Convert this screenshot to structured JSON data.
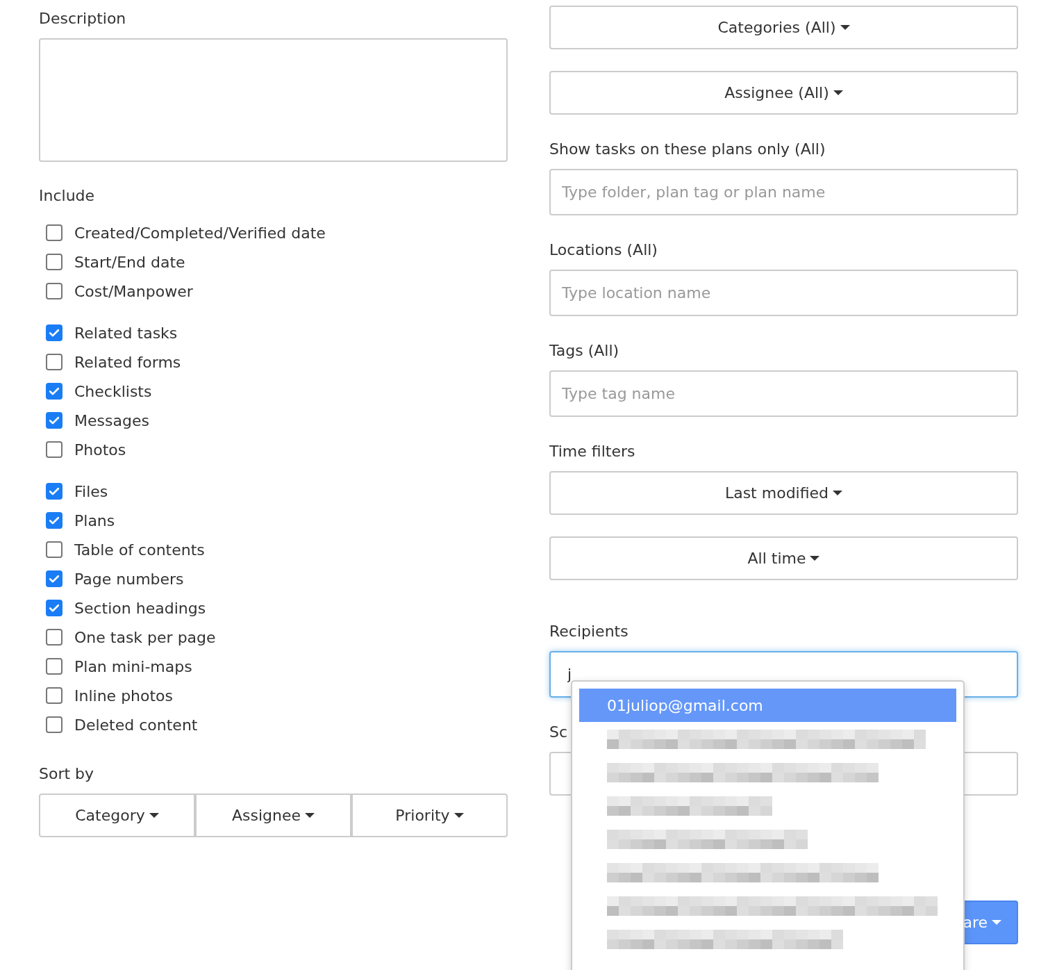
{
  "left": {
    "description": {
      "label": "Description"
    },
    "include": {
      "label": "Include",
      "groups": [
        [
          {
            "label": "Created/Completed/Verified date",
            "checked": false
          },
          {
            "label": "Start/End date",
            "checked": false
          },
          {
            "label": "Cost/Manpower",
            "checked": false
          }
        ],
        [
          {
            "label": "Related tasks",
            "checked": true
          },
          {
            "label": "Related forms",
            "checked": false
          },
          {
            "label": "Checklists",
            "checked": true
          },
          {
            "label": "Messages",
            "checked": true
          },
          {
            "label": "Photos",
            "checked": false
          }
        ],
        [
          {
            "label": "Files",
            "checked": true
          },
          {
            "label": "Plans",
            "checked": true
          },
          {
            "label": "Table of contents",
            "checked": false
          },
          {
            "label": "Page numbers",
            "checked": true
          },
          {
            "label": "Section headings",
            "checked": true
          },
          {
            "label": "One task per page",
            "checked": false
          },
          {
            "label": "Plan mini-maps",
            "checked": false
          },
          {
            "label": "Inline photos",
            "checked": false
          },
          {
            "label": "Deleted content",
            "checked": false
          }
        ]
      ]
    },
    "sort": {
      "label": "Sort by",
      "buttons": [
        "Category",
        "Assignee",
        "Priority"
      ]
    }
  },
  "right": {
    "filter_buttons": [
      "Categories (All)",
      "Assignee (All)"
    ],
    "fields": [
      {
        "label": "Show tasks on these plans only (All)",
        "placeholder": "Type folder, plan tag or plan name"
      },
      {
        "label": "Locations (All)",
        "placeholder": "Type location name"
      },
      {
        "label": "Tags (All)",
        "placeholder": "Type tag name"
      }
    ],
    "time_filters": {
      "label": "Time filters",
      "buttons": [
        "Last modified",
        "All time"
      ]
    },
    "recipients": {
      "label": "Recipients",
      "value": "j"
    },
    "schedule_label": "Sc",
    "share_button": "are",
    "suggestions": [
      {
        "kind": "email",
        "text": "01juliop@gmail.com",
        "selected": true
      },
      {
        "kind": "redacted",
        "selected": false
      },
      {
        "kind": "redacted",
        "selected": false
      },
      {
        "kind": "redacted",
        "selected": false
      },
      {
        "kind": "redacted",
        "selected": false
      },
      {
        "kind": "redacted",
        "selected": false
      },
      {
        "kind": "redacted",
        "selected": false
      },
      {
        "kind": "redacted",
        "selected": false
      }
    ]
  }
}
